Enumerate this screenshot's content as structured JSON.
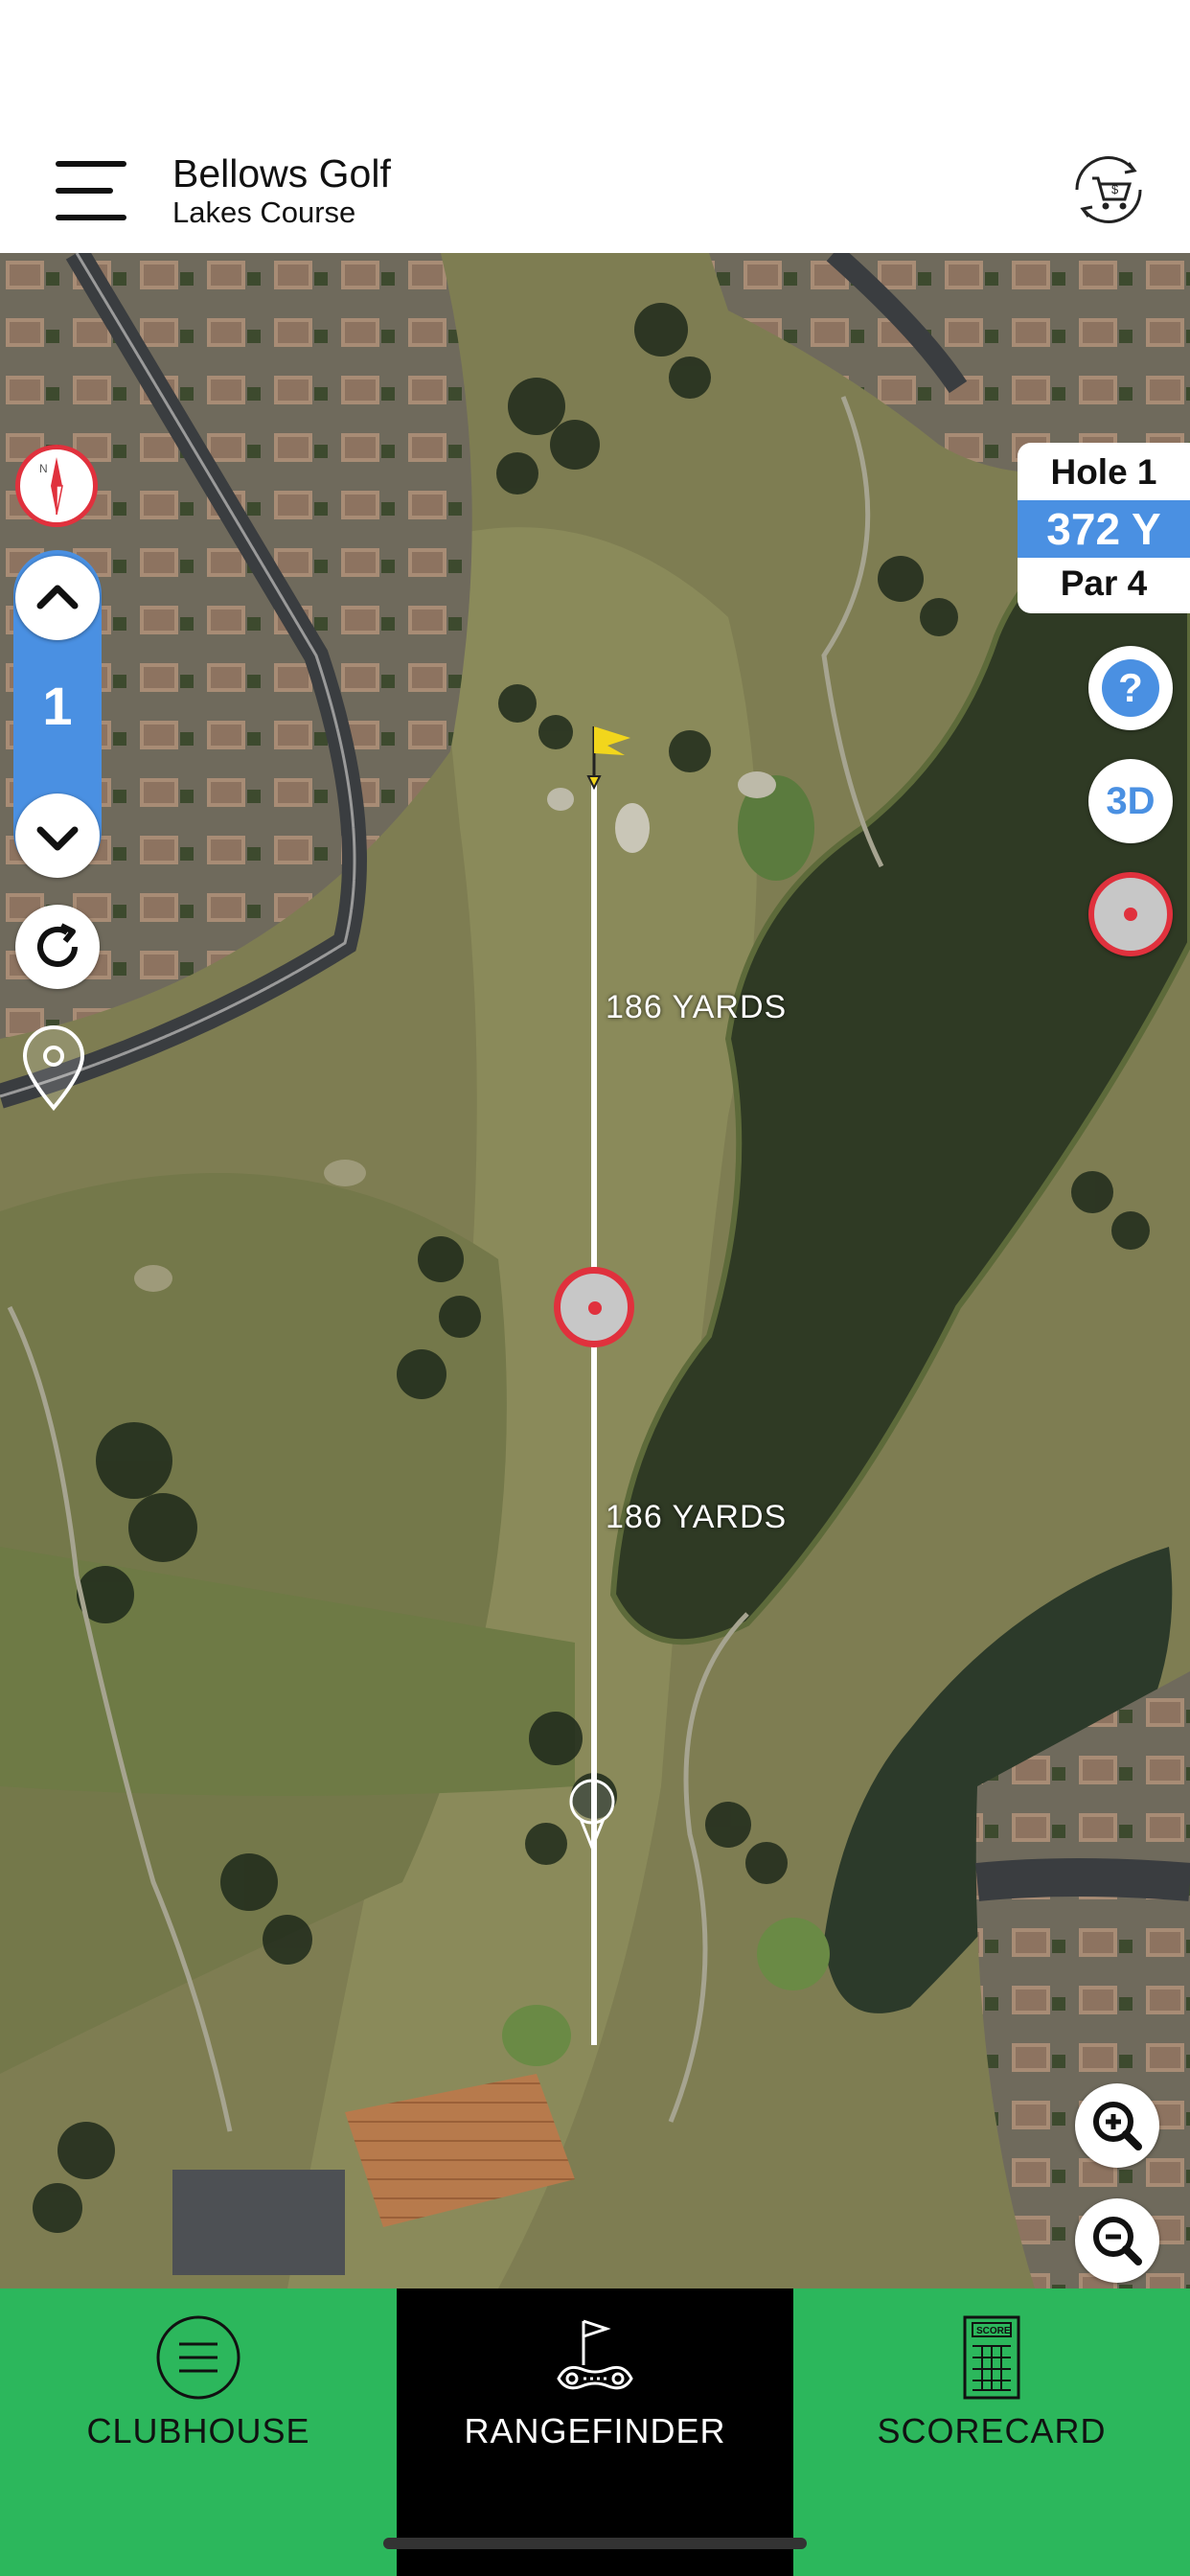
{
  "header": {
    "title": "Bellows Golf",
    "subtitle": "Lakes Course",
    "menu_icon": "hamburger-menu-icon",
    "shop_icon": "shopping-cart-sync-icon"
  },
  "hole_info": {
    "hole_label": "Hole 1",
    "yardage": "372 Y",
    "par": "Par 4"
  },
  "hole_selector": {
    "current_hole": "1"
  },
  "map": {
    "distance_top": "186 YARDS",
    "distance_bottom": "186 YARDS"
  },
  "right_controls": {
    "help_label": "?",
    "three_d_label": "3D"
  },
  "tabs": [
    {
      "label": "CLUBHOUSE",
      "icon": "clubhouse-menu-icon"
    },
    {
      "label": "RANGEFINDER",
      "icon": "rangefinder-flag-icon"
    },
    {
      "label": "SCORECARD",
      "icon": "scorecard-icon"
    }
  ],
  "colors": {
    "accent_blue": "#4a90e2",
    "tab_green": "#2cb75c",
    "tab_active": "#000000",
    "target_red": "#e0313d",
    "flag_yellow": "#f2d61c"
  }
}
